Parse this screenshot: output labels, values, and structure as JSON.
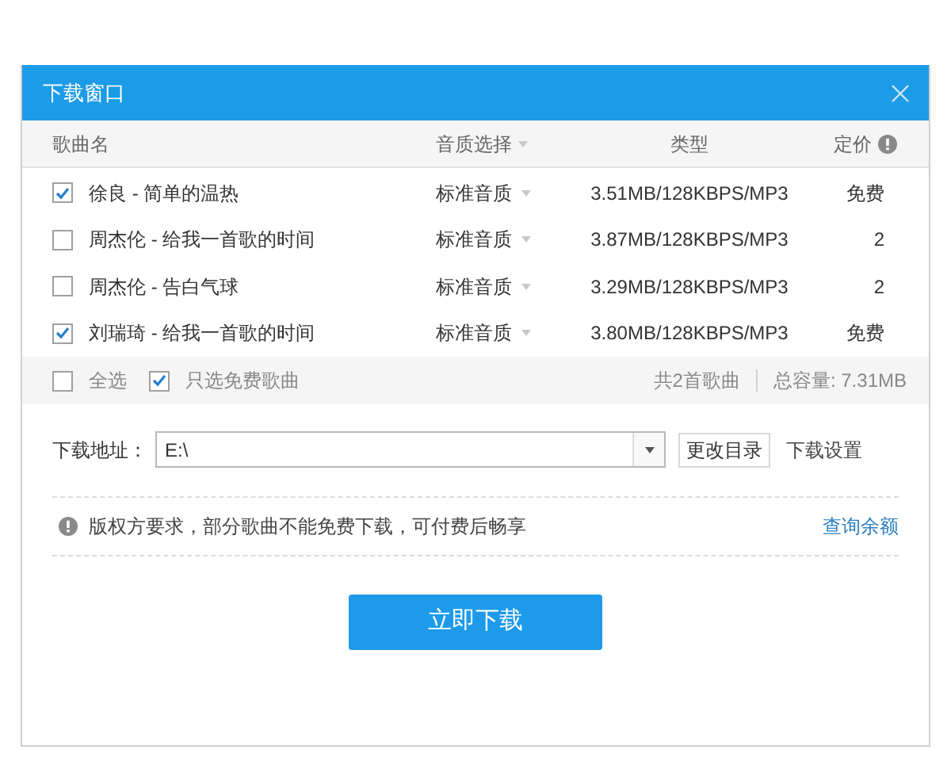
{
  "window": {
    "title": "下载窗口"
  },
  "table": {
    "columns": [
      {
        "label": "歌曲名",
        "kind": "text"
      },
      {
        "label": "音质选择",
        "kind": "sort"
      },
      {
        "label": "类型",
        "kind": "text"
      },
      {
        "label": "定价",
        "kind": "info"
      }
    ],
    "rows": [
      {
        "checked": true,
        "song": "徐良 - 简单的温热",
        "quality": "标准音质",
        "type": "3.51MB/128KBPS/MP3",
        "price": "免费"
      },
      {
        "checked": false,
        "song": "周杰伦 - 给我一首歌的时间",
        "quality": "标准音质",
        "type": "3.87MB/128KBPS/MP3",
        "price": "2"
      },
      {
        "checked": false,
        "song": "周杰伦 - 告白气球",
        "quality": "标准音质",
        "type": "3.29MB/128KBPS/MP3",
        "price": "2"
      },
      {
        "checked": true,
        "song": "刘瑞琦 - 给我一首歌的时间",
        "quality": "标准音质",
        "type": "3.80MB/128KBPS/MP3",
        "price": "免费"
      }
    ]
  },
  "footer": {
    "options": [
      {
        "label": "全选",
        "checked": false
      },
      {
        "label": "只选免费歌曲",
        "checked": true
      }
    ],
    "count": "共2首歌曲",
    "total": "总容量: 7.31MB"
  },
  "download": {
    "label": "下载地址：",
    "path": "E:\\",
    "change_button": "更改目录",
    "settings_link": "下载设置"
  },
  "notice": {
    "text": "版权方要求，部分歌曲不能免费下载，可付费后畅享",
    "link": "查询余额"
  },
  "primary_button": "立即下载"
}
